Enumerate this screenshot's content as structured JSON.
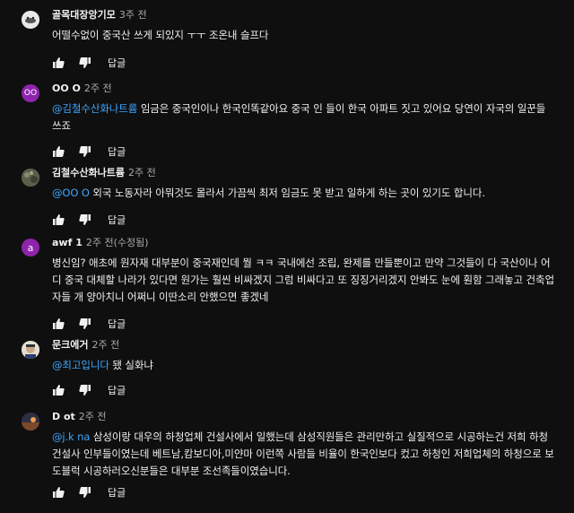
{
  "comments": [
    {
      "author": "골목대장앙기모",
      "time": "3주 전",
      "edited": "",
      "mention": "",
      "text": "어떨수없이 중국산 쓰게 되있지 ㅜㅜ 조온내 슬프다",
      "avatar": {
        "letter": "",
        "color": "#e8e8e8"
      },
      "reply_label": "답글"
    },
    {
      "author": "OO O",
      "time": "2주 전",
      "edited": "",
      "mention": "@김철수산화나트륨",
      "text": "임금은 중국인이나 한국인똑같아요 중국 인 들이 한국 아파트 짓고 있어요 당연이 자국의 일꾼들 쓰죠",
      "avatar": {
        "letter": "OO",
        "color": "#8e24aa"
      },
      "reply_label": "답글"
    },
    {
      "author": "김철수산화나트륨",
      "time": "2주 전",
      "edited": "",
      "mention": "@OO O",
      "text": "외국 노동자라 아뭐것도 몰라서 가끔씩 최저 임금도 못 받고 일하게 하는 곳이 있기도 합니다.",
      "avatar": {
        "letter": "",
        "color": "#6d6d5a"
      },
      "reply_label": "답글"
    },
    {
      "author": "awf 1",
      "time": "2주 전",
      "edited": "(수정됨)",
      "mention": "",
      "text": "병신임? 애초에 원자재 대부분이 중국재인데 뭘 ㅋㅋ 국내에선 조립, 완제를 만들뿐이고 만약 그것들이 다 국산이나 어디 중국 대체할 나라가 있다면 원가는 훨씬 비싸겠지 그럼 비싸다고 또 징징거리겠지 안봐도 눈에 훤함 그래놓고 건축업자들 개 양아치니 어쩌니 이딴소리 안했으면 좋겠네",
      "avatar": {
        "letter": "a",
        "color": "#8e24aa"
      },
      "reply_label": "답글"
    },
    {
      "author": "문크에거",
      "time": "2주 전",
      "edited": "",
      "mention": "@최고입니다",
      "text": "됐 실화냐",
      "avatar": {
        "letter": "",
        "color": "#d9d2c7"
      },
      "reply_label": "답글"
    },
    {
      "author": "D ot",
      "time": "2주 전",
      "edited": "",
      "mention": "@j.k na",
      "text": "삼성이랑 대우의 하청업체 건설사에서 일했는데 삼성직원들은 관리만하고 실질적으로 시공하는건 저희 하청 건설사 인부들이였는데 베트남,캄보디아,미얀마 이런쪽 사람들 비율이 한국인보다 컸고 하청인 저희업체의 하청으로 보도블럭 시공하러오신분들은 대부분 조선족들이였습니다.",
      "avatar": {
        "letter": "",
        "color": "#3a3a4a"
      },
      "reply_label": "답글"
    }
  ],
  "icons": {
    "like": "thumbs-up-icon",
    "dislike": "thumbs-down-icon"
  }
}
